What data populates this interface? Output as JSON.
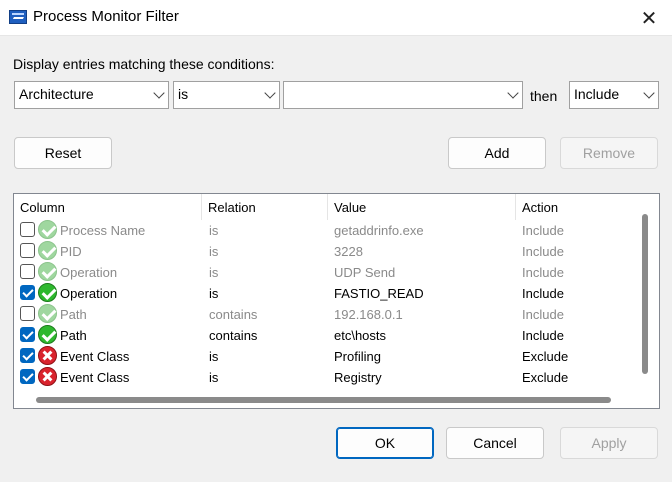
{
  "window": {
    "title": "Process Monitor Filter"
  },
  "prompt": "Display entries matching these conditions:",
  "condition": {
    "column": "Architecture",
    "relation": "is",
    "value": "",
    "then_label": "then",
    "action": "Include"
  },
  "buttons": {
    "reset": "Reset",
    "add": "Add",
    "remove": "Remove",
    "ok": "OK",
    "cancel": "Cancel",
    "apply": "Apply"
  },
  "table": {
    "headers": [
      "Column",
      "Relation",
      "Value",
      "Action"
    ],
    "rows": [
      {
        "checked": false,
        "status": "ok",
        "column": "Process Name",
        "relation": "is",
        "value": "getaddrinfo.exe",
        "action": "Include"
      },
      {
        "checked": false,
        "status": "ok",
        "column": "PID",
        "relation": "is",
        "value": "3228",
        "action": "Include"
      },
      {
        "checked": false,
        "status": "ok",
        "column": "Operation",
        "relation": "is",
        "value": "UDP Send",
        "action": "Include"
      },
      {
        "checked": true,
        "status": "ok",
        "column": "Operation",
        "relation": "is",
        "value": "FASTIO_READ",
        "action": "Include"
      },
      {
        "checked": false,
        "status": "ok",
        "column": "Path",
        "relation": "contains",
        "value": "192.168.0.1",
        "action": "Include"
      },
      {
        "checked": true,
        "status": "ok",
        "column": "Path",
        "relation": "contains",
        "value": "etc\\hosts",
        "action": "Include"
      },
      {
        "checked": true,
        "status": "bad",
        "column": "Event Class",
        "relation": "is",
        "value": "Profiling",
        "action": "Exclude"
      },
      {
        "checked": true,
        "status": "bad",
        "column": "Event Class",
        "relation": "is",
        "value": "Registry",
        "action": "Exclude"
      }
    ]
  },
  "icons": {
    "app": "process-monitor-icon",
    "close": "close-icon",
    "include": "green-check-icon",
    "exclude": "red-x-icon"
  }
}
